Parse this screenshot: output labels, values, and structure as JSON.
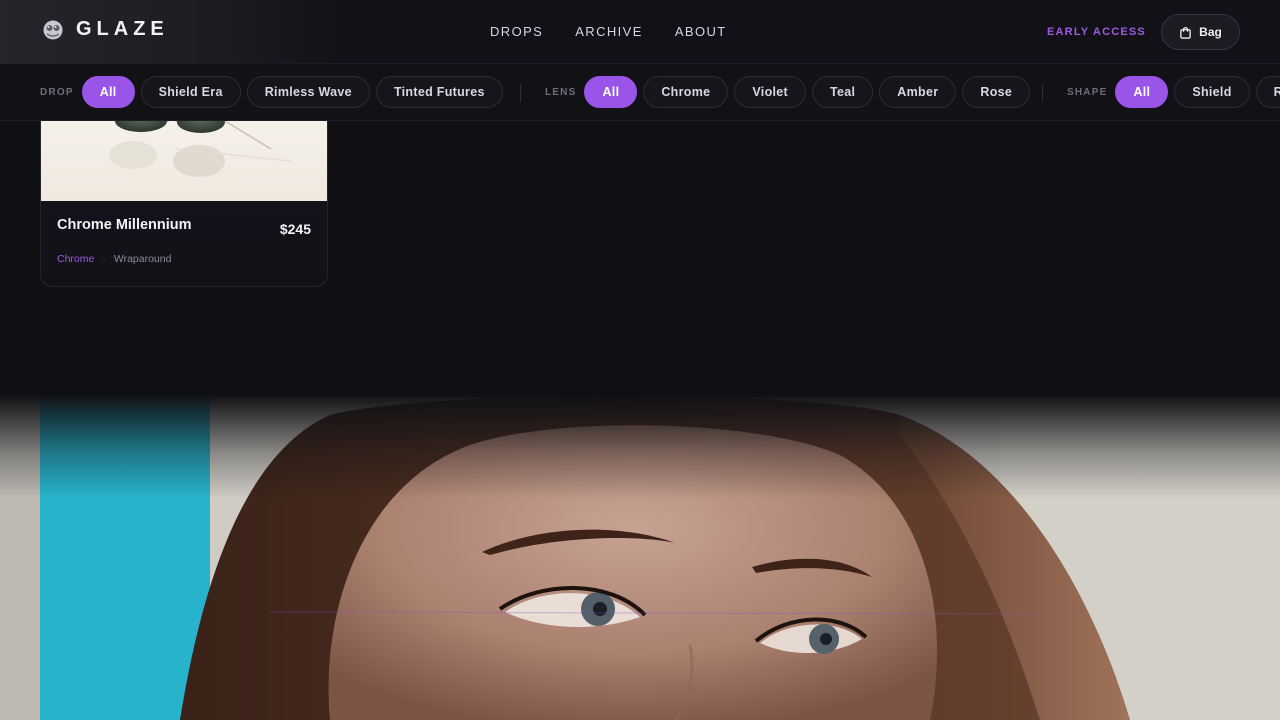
{
  "header": {
    "brand": "GLAZE",
    "nav": [
      "DROPS",
      "ARCHIVE",
      "ABOUT"
    ],
    "early_access": "EARLY ACCESS",
    "bag_label": "Bag"
  },
  "filters": {
    "drop": {
      "label": "DROP",
      "options": [
        "All",
        "Shield Era",
        "Rimless Wave",
        "Tinted Futures"
      ],
      "selected": "All"
    },
    "lens": {
      "label": "LENS",
      "options": [
        "All",
        "Chrome",
        "Violet",
        "Teal",
        "Amber",
        "Rose"
      ],
      "selected": "All"
    },
    "shape": {
      "label": "SHAPE",
      "options": [
        "All",
        "Shield",
        "Ri"
      ],
      "selected": "All"
    }
  },
  "product": {
    "title": "Chrome Millennium",
    "price": "$245",
    "lens": "Chrome",
    "separator": "·",
    "shape": "Wraparound"
  },
  "colors": {
    "accent": "#9b54e8",
    "accent_text": "#9c5ce0",
    "background": "#101014"
  },
  "icons": {
    "logo": "brand-logo-icon",
    "bag": "shopping-bag-icon"
  }
}
